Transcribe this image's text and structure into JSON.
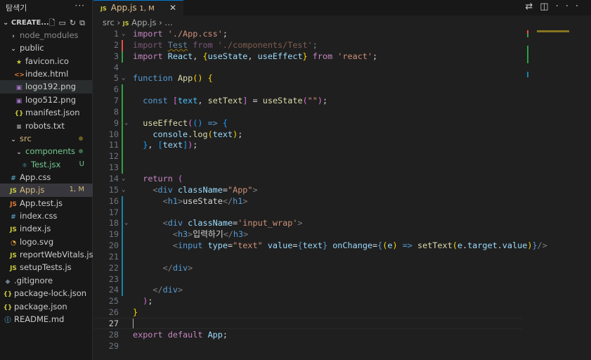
{
  "sidebar": {
    "title": "탐색기",
    "more": "···",
    "project": "CREATE...",
    "items": [
      {
        "label": "node_modules",
        "icon": "›",
        "indent": 1,
        "color": "#8b8b8b",
        "iconColor": "#ccc"
      },
      {
        "label": "public",
        "icon": "⌄",
        "indent": 1,
        "color": "#ccc",
        "iconColor": "#ccc"
      },
      {
        "label": "favicon.ico",
        "icon": "★",
        "indent": 2,
        "color": "#ccc",
        "iconColor": "#cbcb41"
      },
      {
        "label": "index.html",
        "icon": "<>",
        "indent": 2,
        "color": "#ccc",
        "iconColor": "#e37933"
      },
      {
        "label": "logo192.png",
        "icon": "▣",
        "indent": 2,
        "color": "#ccc",
        "iconColor": "#a074c4",
        "hl": true
      },
      {
        "label": "logo512.png",
        "icon": "▣",
        "indent": 2,
        "color": "#ccc",
        "iconColor": "#a074c4"
      },
      {
        "label": "manifest.json",
        "icon": "{}",
        "indent": 2,
        "color": "#ccc",
        "iconColor": "#cbcb41"
      },
      {
        "label": "robots.txt",
        "icon": "≡",
        "indent": 2,
        "color": "#ccc",
        "iconColor": "#ccc"
      },
      {
        "label": "src",
        "icon": "⌄",
        "indent": 1,
        "color": "#d7ba7d",
        "iconColor": "#ccc",
        "dot": "#6b5d21"
      },
      {
        "label": "components",
        "icon": "⌄",
        "indent": 2,
        "color": "#73c991",
        "iconColor": "#ccc",
        "dot": "#3d6b4a"
      },
      {
        "label": "Test.jsx",
        "icon": "⚛",
        "indent": 3,
        "color": "#73c991",
        "iconColor": "#519aba",
        "badge": "U",
        "badgeColor": "#73c991"
      },
      {
        "label": "App.css",
        "icon": "#",
        "indent": 1,
        "color": "#ccc",
        "iconColor": "#519aba"
      },
      {
        "label": "App.js",
        "icon": "JS",
        "indent": 1,
        "color": "#d7ba7d",
        "iconColor": "#cbcb41",
        "badge": "1, M",
        "badgeColor": "#d7ba7d",
        "sel": true
      },
      {
        "label": "App.test.js",
        "icon": "JS",
        "indent": 1,
        "color": "#ccc",
        "iconColor": "#e37933"
      },
      {
        "label": "index.css",
        "icon": "#",
        "indent": 1,
        "color": "#ccc",
        "iconColor": "#519aba"
      },
      {
        "label": "index.js",
        "icon": "JS",
        "indent": 1,
        "color": "#ccc",
        "iconColor": "#cbcb41"
      },
      {
        "label": "logo.svg",
        "icon": "◔",
        "indent": 1,
        "color": "#ccc",
        "iconColor": "#ffb13b"
      },
      {
        "label": "reportWebVitals.js",
        "icon": "JS",
        "indent": 1,
        "color": "#ccc",
        "iconColor": "#cbcb41"
      },
      {
        "label": "setupTests.js",
        "icon": "JS",
        "indent": 1,
        "color": "#ccc",
        "iconColor": "#cbcb41"
      },
      {
        "label": ".gitignore",
        "icon": "◆",
        "indent": 0,
        "color": "#ccc",
        "iconColor": "#6d8086"
      },
      {
        "label": "package-lock.json",
        "icon": "{}",
        "indent": 0,
        "color": "#ccc",
        "iconColor": "#cbcb41"
      },
      {
        "label": "package.json",
        "icon": "{}",
        "indent": 0,
        "color": "#ccc",
        "iconColor": "#cbcb41"
      },
      {
        "label": "README.md",
        "icon": "ⓘ",
        "indent": 0,
        "color": "#ccc",
        "iconColor": "#519aba"
      }
    ]
  },
  "tab": {
    "icon": "JS",
    "label": "App.js",
    "status": "1, M",
    "close": "✕"
  },
  "breadcrumb": {
    "folder": "src",
    "sep": "›",
    "icon": "JS",
    "file": "App.js",
    "more": "…"
  },
  "code": [
    {
      "fold": true,
      "t": [
        [
          "import",
          "kw"
        ],
        [
          " ",
          "pl"
        ],
        [
          "'./App.css'",
          "st"
        ],
        [
          ";",
          "pl"
        ]
      ]
    },
    {
      "g": "#f14c4c",
      "t": [
        [
          "import",
          "kw dim"
        ],
        [
          " ",
          "pl"
        ],
        [
          "Test",
          "vr dim sq"
        ],
        [
          " ",
          "pl"
        ],
        [
          "from",
          "kw dim"
        ],
        [
          " ",
          "pl"
        ],
        [
          "'./components/Test'",
          "st dim"
        ],
        [
          ";",
          "pl dim"
        ]
      ]
    },
    {
      "g": "#2ea043",
      "t": [
        [
          "import",
          "kw"
        ],
        [
          " ",
          "pl"
        ],
        [
          "React",
          "vr"
        ],
        [
          ", ",
          "pl"
        ],
        [
          "{",
          "br1"
        ],
        [
          "useState",
          "vr"
        ],
        [
          ", ",
          "pl"
        ],
        [
          "useEffect",
          "vr"
        ],
        [
          "}",
          "br1"
        ],
        [
          " ",
          "pl"
        ],
        [
          "from",
          "kw"
        ],
        [
          " ",
          "pl"
        ],
        [
          "'react'",
          "st"
        ],
        [
          ";",
          "pl"
        ]
      ]
    },
    {
      "t": []
    },
    {
      "fold": true,
      "t": [
        [
          "function",
          "kb"
        ],
        [
          " ",
          "pl"
        ],
        [
          "App",
          "fn"
        ],
        [
          "()",
          "br1"
        ],
        [
          " ",
          "pl"
        ],
        [
          "{",
          "br1"
        ]
      ]
    },
    {
      "g": "#2ea043",
      "t": []
    },
    {
      "g": "#2ea043",
      "t": [
        [
          "  ",
          "pl"
        ],
        [
          "const",
          "kb"
        ],
        [
          " ",
          "pl"
        ],
        [
          "[",
          "br2"
        ],
        [
          "text",
          "cn"
        ],
        [
          ", ",
          "pl"
        ],
        [
          "setText",
          "fn"
        ],
        [
          "]",
          "br2"
        ],
        [
          " = ",
          "pl"
        ],
        [
          "useState",
          "fn"
        ],
        [
          "(",
          "br2"
        ],
        [
          "\"\"",
          "st"
        ],
        [
          ")",
          "br2"
        ],
        [
          ";",
          "pl"
        ]
      ]
    },
    {
      "g": "#2ea043",
      "t": []
    },
    {
      "g": "#2ea043",
      "fold": true,
      "t": [
        [
          "  ",
          "pl"
        ],
        [
          "useEffect",
          "fn"
        ],
        [
          "(",
          "br2"
        ],
        [
          "()",
          "br3"
        ],
        [
          " ",
          "pl"
        ],
        [
          "=>",
          "kb"
        ],
        [
          " ",
          "pl"
        ],
        [
          "{",
          "br3"
        ]
      ]
    },
    {
      "g": "#2ea043",
      "t": [
        [
          "    ",
          "pl"
        ],
        [
          "console",
          "vr"
        ],
        [
          ".",
          "pl"
        ],
        [
          "log",
          "fn"
        ],
        [
          "(",
          "br1"
        ],
        [
          "text",
          "vr"
        ],
        [
          ")",
          "br1"
        ],
        [
          ";",
          "pl"
        ]
      ]
    },
    {
      "g": "#2ea043",
      "t": [
        [
          "  ",
          "pl"
        ],
        [
          "}",
          "br3"
        ],
        [
          ", ",
          "pl"
        ],
        [
          "[",
          "br3"
        ],
        [
          "text",
          "vr"
        ],
        [
          "]",
          "br3"
        ],
        [
          ")",
          "br2"
        ],
        [
          ";",
          "pl"
        ]
      ]
    },
    {
      "g": "#2ea043",
      "t": []
    },
    {
      "g": "#2ea043",
      "t": []
    },
    {
      "fold": true,
      "t": [
        [
          "  ",
          "pl"
        ],
        [
          "return",
          "kw"
        ],
        [
          " ",
          "pl"
        ],
        [
          "(",
          "br2"
        ]
      ]
    },
    {
      "fold": true,
      "t": [
        [
          "    ",
          "pl"
        ],
        [
          "<",
          "pc"
        ],
        [
          "div",
          "tg"
        ],
        [
          " ",
          "pl"
        ],
        [
          "className",
          "vr"
        ],
        [
          "=",
          "pl"
        ],
        [
          "\"App\"",
          "st"
        ],
        [
          ">",
          "pc"
        ]
      ]
    },
    {
      "g": "#1b81a8",
      "t": [
        [
          "      ",
          "pl"
        ],
        [
          "<",
          "pc"
        ],
        [
          "h1",
          "tg"
        ],
        [
          ">",
          "pc"
        ],
        [
          "useState",
          "pl"
        ],
        [
          "</",
          "pc"
        ],
        [
          "h1",
          "tg"
        ],
        [
          ">",
          "pc"
        ]
      ]
    },
    {
      "g": "#1b81a8",
      "t": []
    },
    {
      "g": "#1b81a8",
      "fold": true,
      "t": [
        [
          "      ",
          "pl"
        ],
        [
          "<",
          "pc"
        ],
        [
          "div",
          "tg"
        ],
        [
          " ",
          "pl"
        ],
        [
          "className",
          "vr"
        ],
        [
          "=",
          "pl"
        ],
        [
          "'input_wrap'",
          "st"
        ],
        [
          ">",
          "pc"
        ]
      ]
    },
    {
      "g": "#1b81a8",
      "t": [
        [
          "        ",
          "pl"
        ],
        [
          "<",
          "pc"
        ],
        [
          "h3",
          "tg"
        ],
        [
          ">",
          "pc"
        ],
        [
          "입력하기",
          "pl"
        ],
        [
          "</",
          "pc"
        ],
        [
          "h3",
          "tg"
        ],
        [
          ">",
          "pc"
        ]
      ]
    },
    {
      "g": "#1b81a8",
      "t": [
        [
          "        ",
          "pl"
        ],
        [
          "<",
          "pc"
        ],
        [
          "input",
          "tg"
        ],
        [
          " ",
          "pl"
        ],
        [
          "type",
          "vr"
        ],
        [
          "=",
          "pl"
        ],
        [
          "\"text\"",
          "st"
        ],
        [
          " ",
          "pl"
        ],
        [
          "value",
          "vr"
        ],
        [
          "=",
          "pl"
        ],
        [
          "{",
          "kb"
        ],
        [
          "text",
          "vr"
        ],
        [
          "}",
          "kb"
        ],
        [
          " ",
          "pl"
        ],
        [
          "onChange",
          "vr"
        ],
        [
          "=",
          "pl"
        ],
        [
          "{",
          "kb"
        ],
        [
          "(",
          "br1"
        ],
        [
          "e",
          "vr"
        ],
        [
          ")",
          "br1"
        ],
        [
          " ",
          "pl"
        ],
        [
          "=>",
          "kb"
        ],
        [
          " ",
          "pl"
        ],
        [
          "setText",
          "fn"
        ],
        [
          "(",
          "br1"
        ],
        [
          "e",
          "vr"
        ],
        [
          ".",
          "pl"
        ],
        [
          "target",
          "vr"
        ],
        [
          ".",
          "pl"
        ],
        [
          "value",
          "vr"
        ],
        [
          ")",
          "br1"
        ],
        [
          "}",
          "kb"
        ],
        [
          "/>",
          "pc"
        ]
      ]
    },
    {
      "g": "#1b81a8",
      "t": []
    },
    {
      "g": "#1b81a8",
      "t": [
        [
          "      ",
          "pl"
        ],
        [
          "</",
          "pc"
        ],
        [
          "div",
          "tg"
        ],
        [
          ">",
          "pc"
        ]
      ]
    },
    {
      "g": "#1b81a8",
      "t": []
    },
    {
      "g": "#1b81a8",
      "t": [
        [
          "    ",
          "pl"
        ],
        [
          "</",
          "pc"
        ],
        [
          "div",
          "tg"
        ],
        [
          ">",
          "pc"
        ]
      ]
    },
    {
      "t": [
        [
          "  ",
          "pl"
        ],
        [
          ")",
          "br2"
        ],
        [
          ";",
          "pl"
        ]
      ]
    },
    {
      "t": [
        [
          "}",
          "br1"
        ]
      ]
    },
    {
      "cur": true,
      "t": []
    },
    {
      "t": [
        [
          "export",
          "kw"
        ],
        [
          " ",
          "pl"
        ],
        [
          "default",
          "kw"
        ],
        [
          " ",
          "pl"
        ],
        [
          "App",
          "vr"
        ],
        [
          ";",
          "pl"
        ]
      ]
    },
    {
      "t": []
    }
  ]
}
